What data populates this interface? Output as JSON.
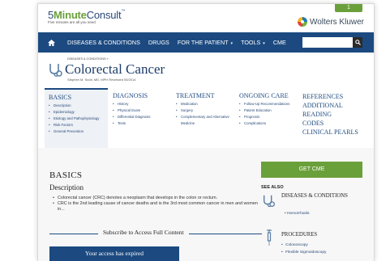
{
  "brand": {
    "name_prefix": "5",
    "name_green": "Minute",
    "name_suffix": "Consult",
    "tm": "™",
    "tagline": "Five minutes are all you need"
  },
  "publisher": "Wolters Kluwer",
  "login_tab": "1",
  "nav": {
    "items": [
      {
        "label": "DISEASES & CONDITIONS"
      },
      {
        "label": "DRUGS"
      },
      {
        "label": "FOR THE PATIENT"
      },
      {
        "label": "TOOLS"
      },
      {
        "label": "CME"
      }
    ],
    "caret": "▾"
  },
  "page": {
    "breadcrumb": "DISEASES & CONDITIONS »",
    "title": "Colorectal Cancer",
    "byline": "Stephen M. Scott, MD, MPH Reviewed 05/2014"
  },
  "sections": {
    "basics": {
      "heading": "BASICS",
      "items": [
        "Description",
        "Epidemiology",
        "Etiology and Pathophysiology",
        "Risk Factors",
        "General Prevention"
      ]
    },
    "diagnosis": {
      "heading": "DIAGNOSIS",
      "items": [
        "History",
        "Physical Exam",
        "Differential Diagnosis",
        "Tests"
      ]
    },
    "treatment": {
      "heading": "TREATMENT",
      "items": [
        "Medication",
        "Surgery",
        "Complementary and Alternative Medicine"
      ]
    },
    "ongoing_care": {
      "heading": "ONGOING CARE",
      "items": [
        "Follow-Up Recommendations",
        "Patient Education",
        "Prognosis",
        "Complications"
      ]
    },
    "references": {
      "links": [
        "REFERENCES",
        "ADDITIONAL READING",
        "CODES",
        "CLINICAL PEARLS"
      ]
    }
  },
  "main": {
    "section_title": "BASICS",
    "subsection_title": "Description",
    "bullets": [
      "Colorectal cancer (CRC) denotes a neoplasm that develops in the colon or rectum.",
      "CRC is the 2nd leading cause of cancer deaths and is the 3rd most common cancer in men and women in..."
    ],
    "subscribe_text": "Subscribe to Access Full Content",
    "expired_label": "Your access has expired"
  },
  "sidebar": {
    "cme_button": "GET CME",
    "see_also": "SEE ALSO",
    "diseases_heading": "DISEASES & CONDITIONS",
    "diseases_link": "Hemorrhoids",
    "procedures_heading": "PROCEDURES",
    "procedures_links": [
      "Colonoscopy",
      "Flexible Sigmoidoscopy"
    ]
  },
  "colors": {
    "nav_blue": "#1c4a80",
    "accent_green": "#6aa03a"
  }
}
